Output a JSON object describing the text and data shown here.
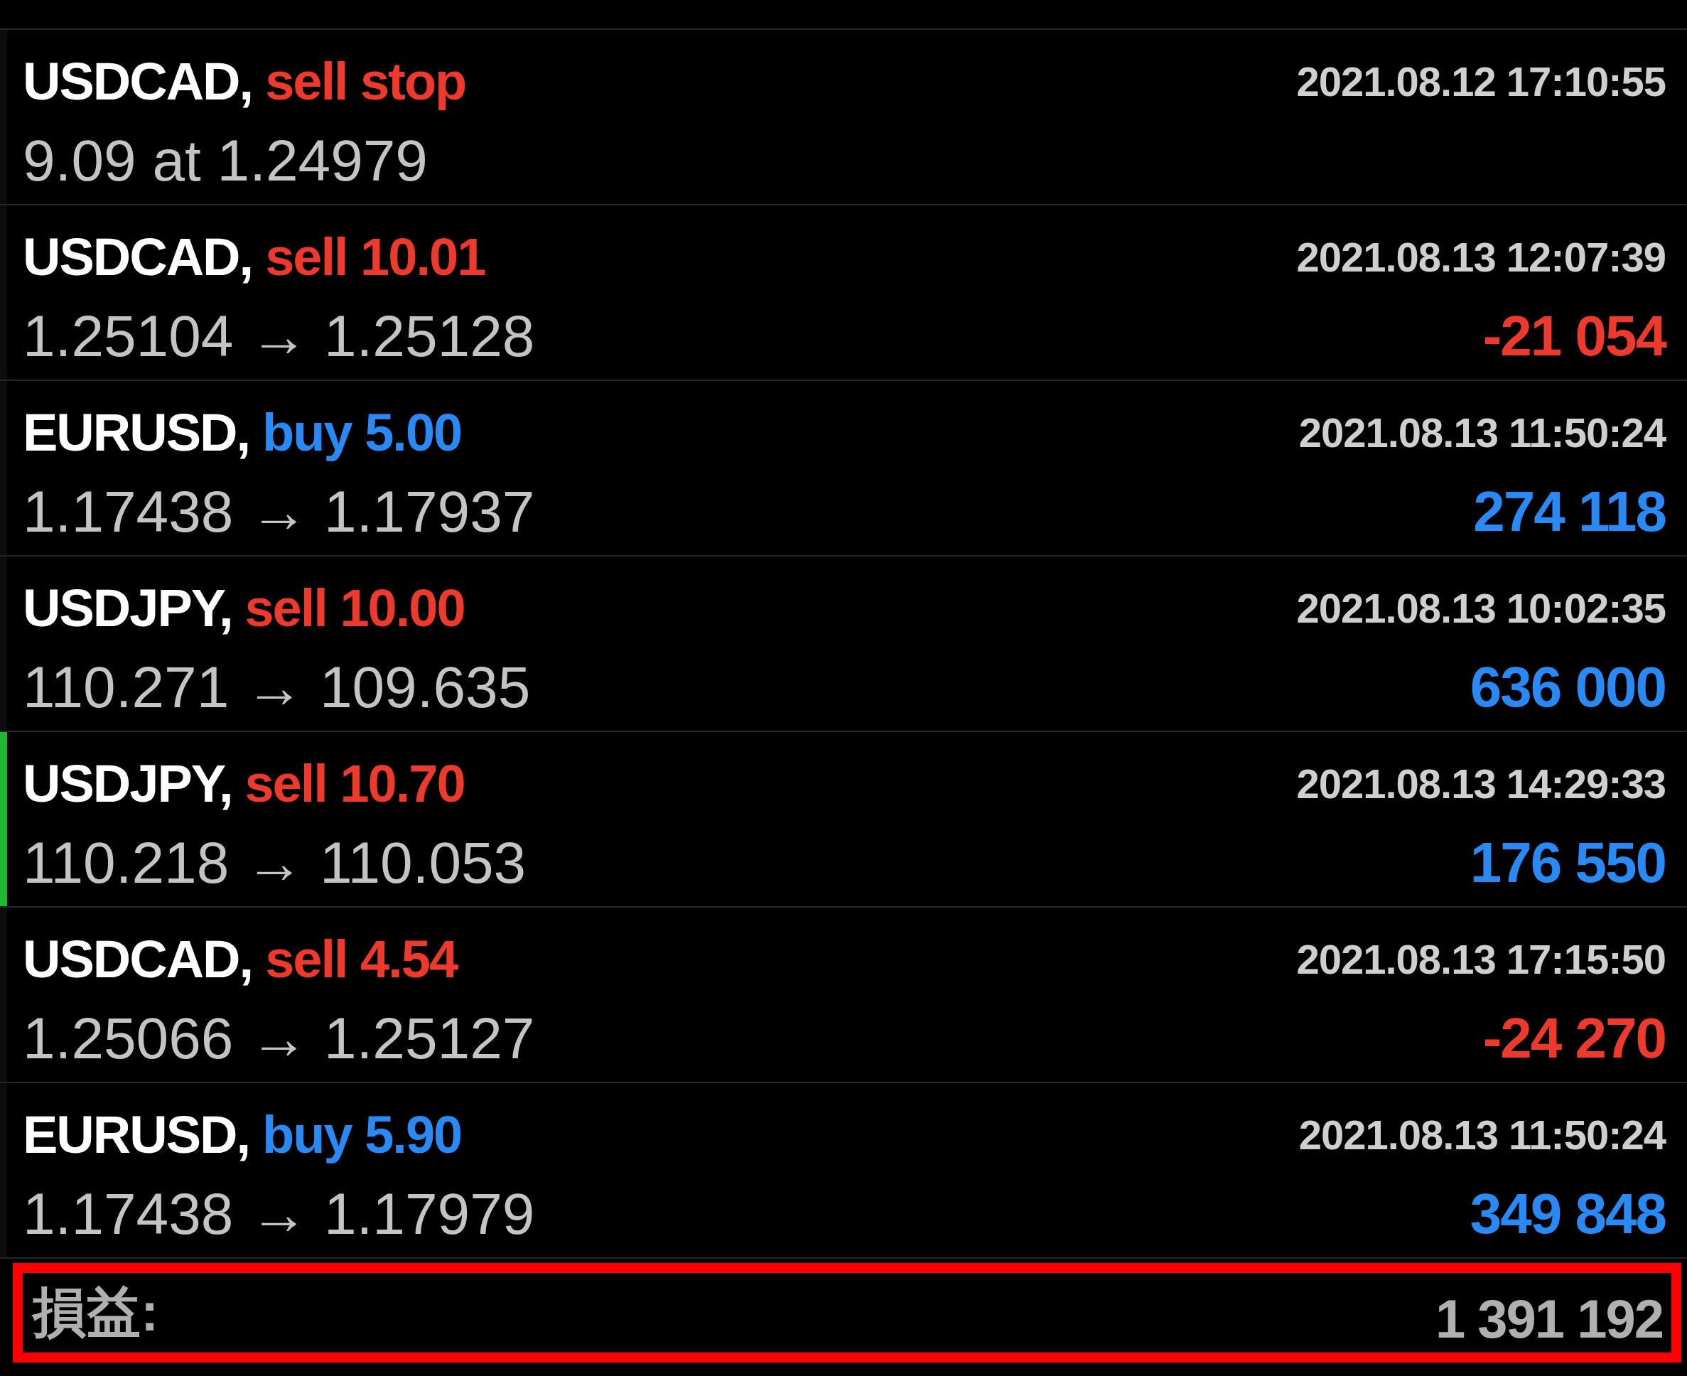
{
  "orders": [
    {
      "symbol": "USDCAD,",
      "order": "sell stop",
      "kind": "sell",
      "date": "2021.08.12 17:10:55",
      "prices": "9.09 at 1.24979",
      "selected": false
    },
    {
      "symbol": "USDCAD,",
      "order": "sell 10.01",
      "kind": "sell",
      "date": "2021.08.13 12:07:39",
      "prices": "1.25104 → 1.25128",
      "profit": {
        "text": "-21 054",
        "kind": "loss"
      },
      "selected": false
    },
    {
      "symbol": "EURUSD,",
      "order": "buy 5.00",
      "kind": "buy",
      "date": "2021.08.13 11:50:24",
      "prices": "1.17438 → 1.17937",
      "profit": {
        "text": "274 118",
        "kind": "gain"
      },
      "selected": false
    },
    {
      "symbol": "USDJPY,",
      "order": "sell 10.00",
      "kind": "sell",
      "date": "2021.08.13 10:02:35",
      "prices": "110.271 → 109.635",
      "profit": {
        "text": "636 000",
        "kind": "gain"
      },
      "selected": false
    },
    {
      "symbol": "USDJPY,",
      "order": "sell 10.70",
      "kind": "sell",
      "date": "2021.08.13 14:29:33",
      "prices": "110.218 → 110.053",
      "profit": {
        "text": "176 550",
        "kind": "gain"
      },
      "selected": true
    },
    {
      "symbol": "USDCAD,",
      "order": "sell 4.54",
      "kind": "sell",
      "date": "2021.08.13 17:15:50",
      "prices": "1.25066 → 1.25127",
      "profit": {
        "text": "-24 270",
        "kind": "loss"
      },
      "selected": false
    },
    {
      "symbol": "EURUSD,",
      "order": "buy 5.90",
      "kind": "buy",
      "date": "2021.08.13 11:50:24",
      "prices": "1.17438 → 1.17979",
      "profit": {
        "text": "349 848",
        "kind": "gain"
      },
      "selected": false
    }
  ],
  "total": {
    "label": "損益:",
    "value": "1 391 192"
  }
}
